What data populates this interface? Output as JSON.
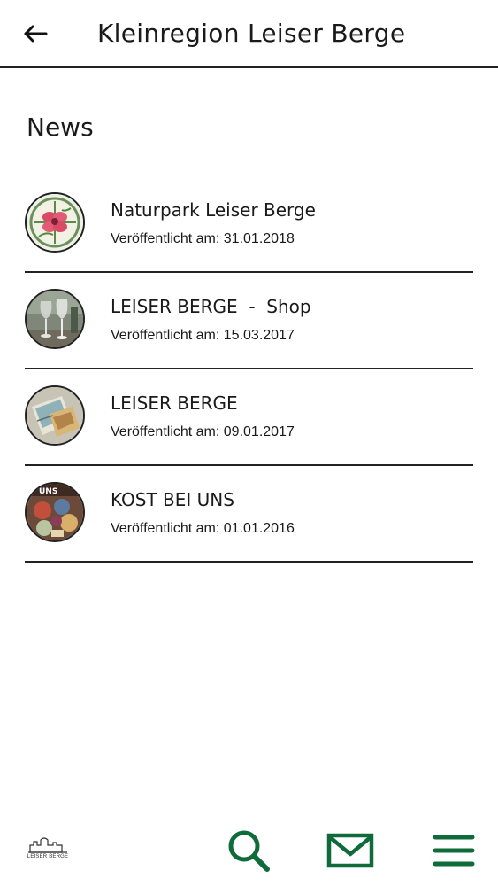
{
  "header": {
    "title": "Kleinregion Leiser Berge",
    "back_icon": "arrow-left-icon"
  },
  "section": {
    "title": "News"
  },
  "news": [
    {
      "title": "Naturpark Leiser Berge",
      "date": "Veröffentlicht am: 31.01.2018",
      "thumb": "flower-seal-thumbnail"
    },
    {
      "title": "LEISER BERGE  -  Shop",
      "date": "Veröffentlicht am: 15.03.2017",
      "thumb": "wine-glasses-thumbnail"
    },
    {
      "title": "LEISER BERGE",
      "date": "Veröffentlicht am: 09.01.2017",
      "thumb": "brochure-thumbnail"
    },
    {
      "title": "KOST BEI UNS",
      "date": "Veröffentlicht am: 01.01.2016",
      "thumb": "food-collage-thumbnail"
    }
  ],
  "bottom_nav": {
    "logo_text": "LEISER BERGE",
    "icons": [
      "search-icon",
      "mail-icon",
      "menu-icon"
    ],
    "accent_color": "#0f6b3a"
  }
}
